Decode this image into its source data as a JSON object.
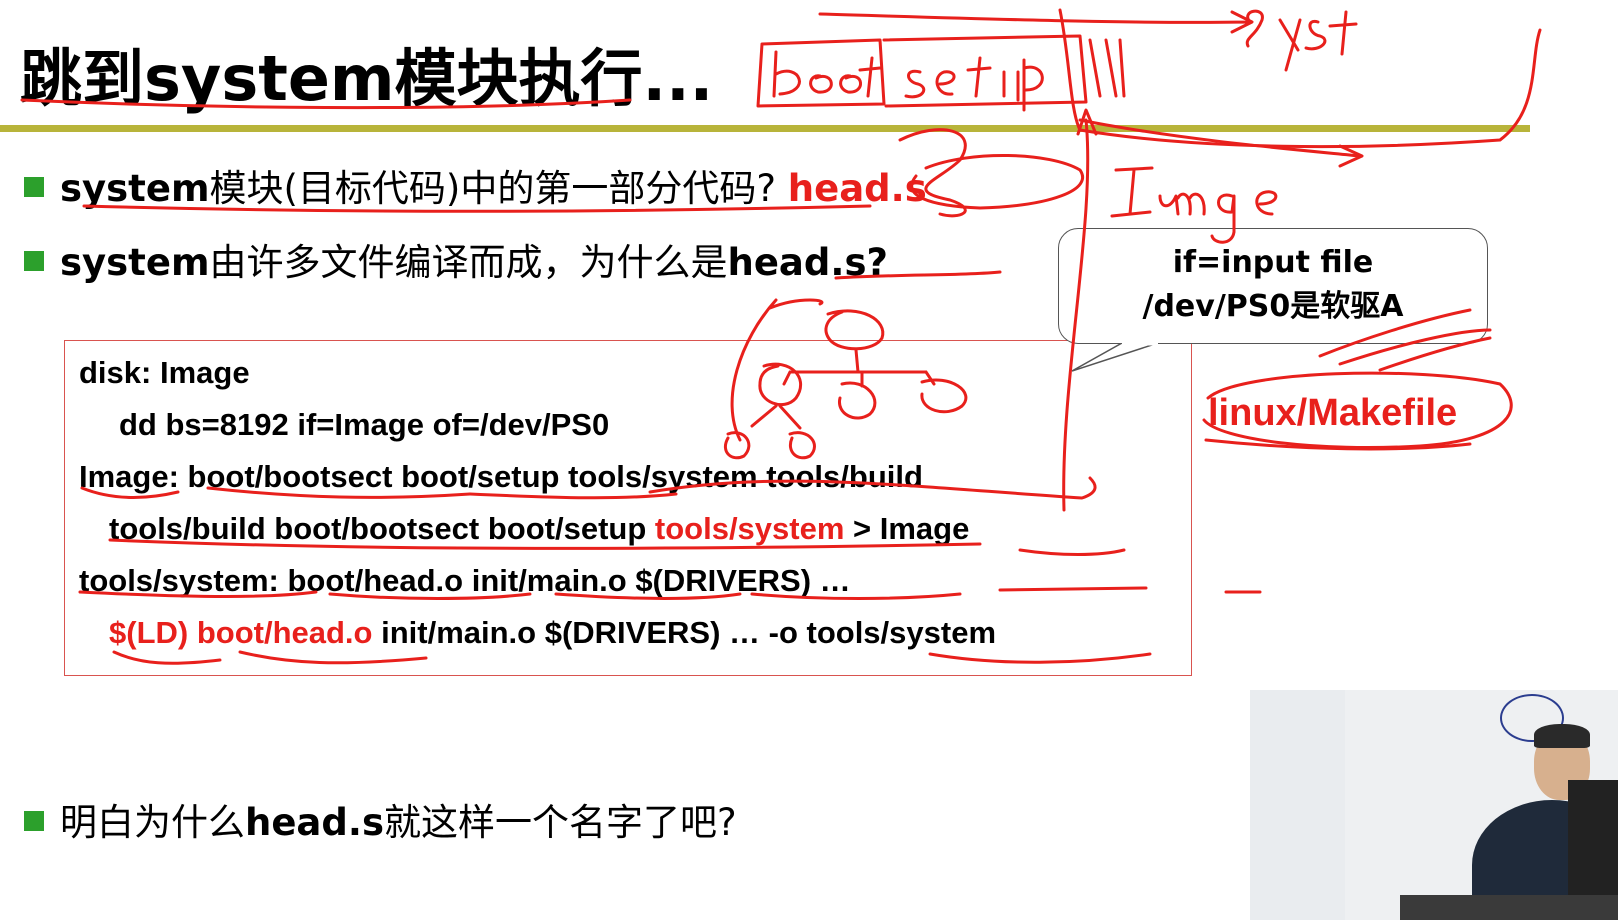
{
  "slide": {
    "title": "跳到system模块执行...",
    "bullets": [
      {
        "bold_start": "system",
        "text": "模块(目标代码)中的第一部分代码?",
        "answer": "head.s"
      },
      {
        "bold_start": "system",
        "text": "由许多文件编译而成，为什么是",
        "bold_end": "head.s?"
      },
      {
        "text": "明白为什么",
        "bold": "head.s",
        "text_end": "就这样一个名字了吧?"
      }
    ],
    "code": {
      "line1": "disk: Image",
      "line2": "dd bs=8192 if=Image of=/dev/PS0",
      "line3": "Image: boot/bootsect  boot/setup tools/system tools/build",
      "line4_a": "tools/build boot/bootsect boot/setup ",
      "line4_red": "tools/system",
      "line4_b": " > Image",
      "line5": "tools/system: boot/head.o  init/main.o $(DRIVERS) …",
      "line6_red": "$(LD) boot/head.o",
      "line6_b": " init/main.o $(DRIVERS) … -o tools/system"
    },
    "callout": {
      "line1": "if=input file",
      "line2": "/dev/PS0是软驱A"
    },
    "makefile_label": "linux/Makefile"
  },
  "colors": {
    "accent_red": "#e8201c",
    "bullet_green": "#2ca02c",
    "rule_olive": "#b8b43a",
    "ink_red": "#e8201c"
  }
}
